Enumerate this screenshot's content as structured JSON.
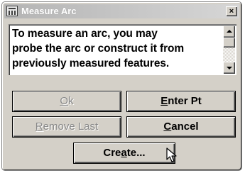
{
  "window": {
    "title": "Measure Arc",
    "close_label": "×"
  },
  "message": {
    "lines": [
      "To measure an arc, you may",
      "probe the arc or construct it from",
      "previously measured features."
    ]
  },
  "buttons": {
    "ok": {
      "pre": "",
      "accel": "O",
      "post": "k",
      "enabled": false
    },
    "enter": {
      "pre": "",
      "accel": "E",
      "post": "nter Pt",
      "enabled": true
    },
    "remove": {
      "pre": "",
      "accel": "R",
      "post": "emove Last",
      "enabled": false
    },
    "cancel": {
      "pre": "",
      "accel": "C",
      "post": "ancel",
      "enabled": true
    },
    "create": {
      "pre": "Cre",
      "accel": "a",
      "post": "te...",
      "enabled": true
    }
  },
  "icons": {
    "app": "app-icon",
    "cursor": "mouse-pointer-icon"
  }
}
